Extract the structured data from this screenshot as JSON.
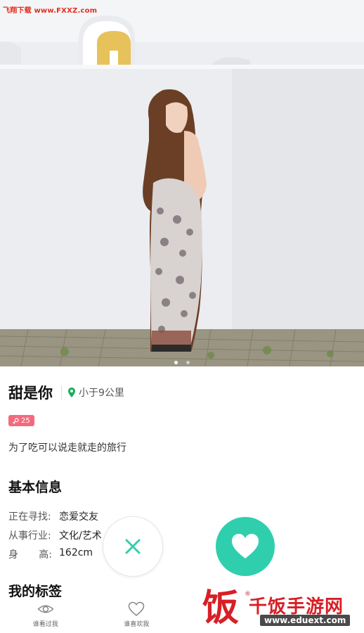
{
  "watermark_top": "飞翔下载 www.FXXZ.com",
  "profile": {
    "name": "甜是你",
    "distance": "小于9公里",
    "age": "25",
    "signature": "为了吃可以说走就走的旅行"
  },
  "basic_info": {
    "title": "基本信息",
    "rows": [
      {
        "label": "正在寻找:",
        "value": "恋爱交友"
      },
      {
        "label": "从事行业:",
        "value": "文化/艺术"
      },
      {
        "label_a": "身",
        "label_b": "高:",
        "value": "162cm"
      }
    ]
  },
  "tags": {
    "title": "我的标签"
  },
  "nav": [
    {
      "label": "谁看过我",
      "icon": "eye-icon"
    },
    {
      "label": "谁喜欢我",
      "icon": "heart-outline-icon"
    }
  ],
  "logo_watermark": {
    "han": "饭",
    "text": "千饭手游网",
    "url": "www.eduext.com"
  },
  "colors": {
    "accent": "#2fcfae",
    "age_badge": "#f46a7d",
    "location_pin": "#17b05a",
    "logo": "#d81f26"
  }
}
